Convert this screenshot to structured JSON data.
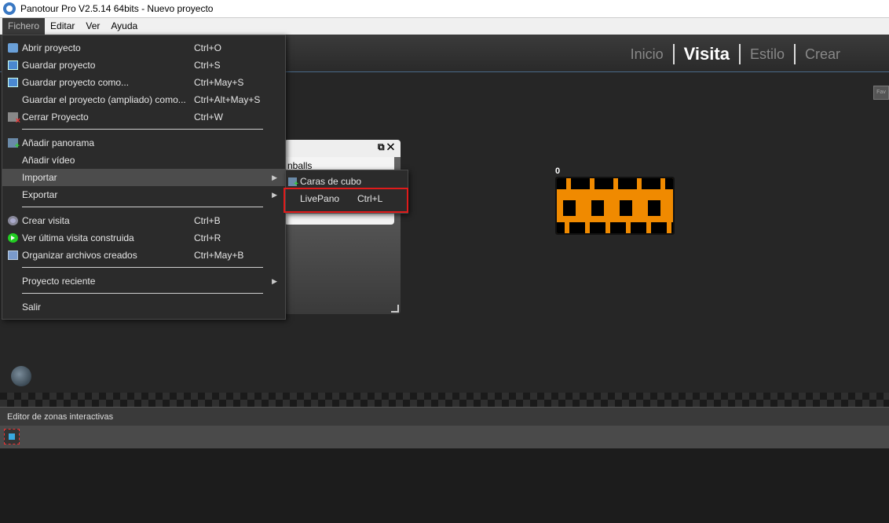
{
  "window": {
    "title": "Panotour Pro V2.5.14 64bits - Nuevo proyecto"
  },
  "menubar": {
    "items": [
      "Fichero",
      "Editar",
      "Ver",
      "Ayuda"
    ]
  },
  "nav_tabs": [
    "Inicio",
    "Visita",
    "Estilo",
    "Crear"
  ],
  "current_tab": "Visita",
  "side_button": "Fav",
  "panel": {
    "text": "nballs"
  },
  "pano": {
    "index": "0"
  },
  "file_menu": {
    "items": [
      {
        "label": "Abrir proyecto",
        "shortcut": "Ctrl+O",
        "icon": "open-folder-icon"
      },
      {
        "label": "Guardar proyecto",
        "shortcut": "Ctrl+S",
        "icon": "save-icon"
      },
      {
        "label": "Guardar proyecto como...",
        "shortcut": "Ctrl+May+S",
        "icon": "save-as-icon"
      },
      {
        "label": "Guardar el proyecto (ampliado) como...",
        "shortcut": "Ctrl+Alt+May+S",
        "icon": ""
      },
      {
        "label": "Cerrar Proyecto",
        "shortcut": "Ctrl+W",
        "icon": "close-project-icon"
      },
      {
        "label": "Añadir panorama",
        "shortcut": "",
        "icon": "add-panorama-icon"
      },
      {
        "label": "Añadir vídeo",
        "shortcut": "",
        "icon": ""
      },
      {
        "label": "Importar",
        "shortcut": "",
        "icon": "",
        "submenu": true
      },
      {
        "label": "Exportar",
        "shortcut": "",
        "icon": "",
        "submenu": true
      },
      {
        "label": "Crear visita",
        "shortcut": "Ctrl+B",
        "icon": "gear-icon"
      },
      {
        "label": "Ver última visita construida",
        "shortcut": "Ctrl+R",
        "icon": "play-icon"
      },
      {
        "label": "Organizar archivos creados",
        "shortcut": "Ctrl+May+B",
        "icon": "files-icon"
      },
      {
        "label": "Proyecto reciente",
        "shortcut": "",
        "icon": "",
        "submenu": true
      },
      {
        "label": "Salir",
        "shortcut": "",
        "icon": ""
      }
    ]
  },
  "import_submenu": {
    "items": [
      {
        "label": "Caras de cubo",
        "shortcut": ""
      },
      {
        "label": "LivePano",
        "shortcut": "Ctrl+L"
      }
    ]
  },
  "zone_editor": {
    "title": "Editor de zonas interactivas"
  },
  "colors": {
    "highlight_border": "#e01b1b",
    "accent": "#4a6a8a"
  }
}
